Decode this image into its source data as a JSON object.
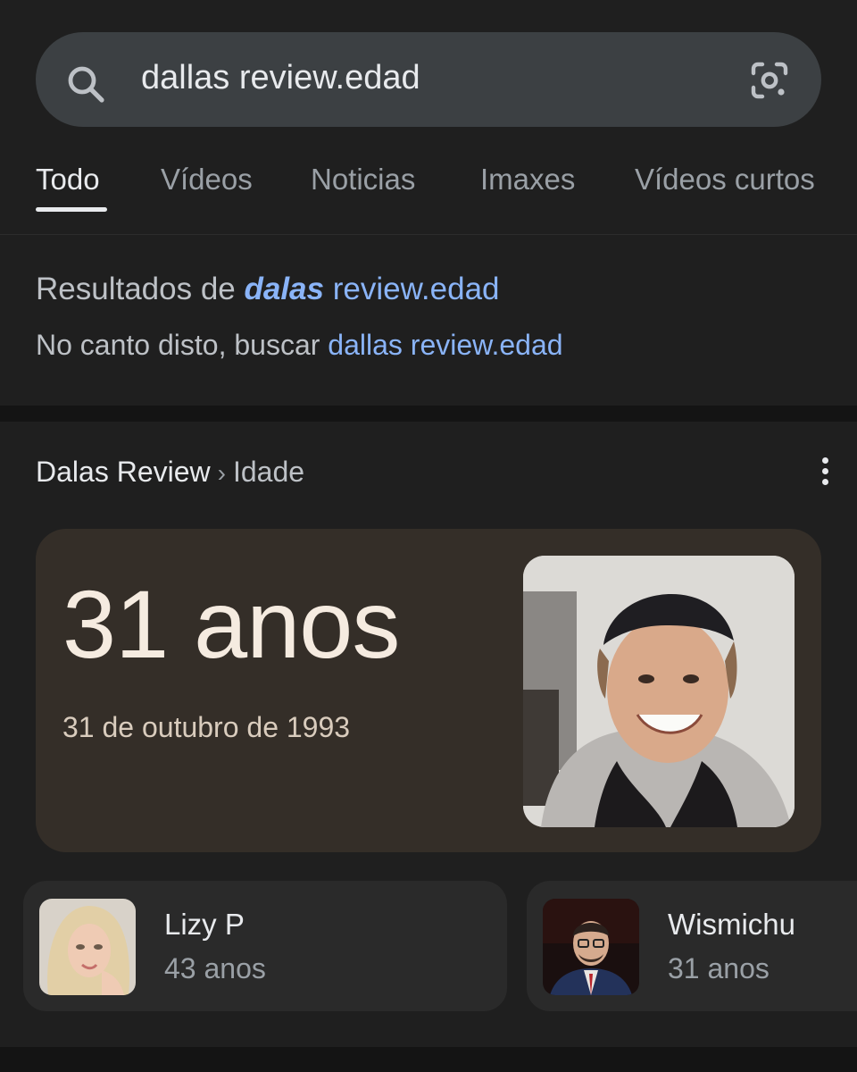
{
  "search": {
    "query": "dallas review.edad",
    "search_icon": "search-icon",
    "lens_icon": "google-lens-icon"
  },
  "tabs": [
    {
      "label": "Todo",
      "active": true
    },
    {
      "label": "Vídeos",
      "active": false
    },
    {
      "label": "Noticias",
      "active": false
    },
    {
      "label": "Imaxes",
      "active": false
    },
    {
      "label": "Vídeos curtos",
      "active": false
    }
  ],
  "spelling": {
    "prefix": "Resultados de ",
    "corrected_word": "dalas",
    "corrected_rest": " review.edad",
    "instead_prefix": "No canto disto, buscar ",
    "original_query": "dallas review.edad"
  },
  "breadcrumb": {
    "entity": "Dalas Review",
    "separator": "›",
    "attribute": "Idade"
  },
  "age_card": {
    "age": "31 anos",
    "birth_date": "31 de outubro de 1993",
    "photo": "portrait of young man with backwards cap"
  },
  "related": [
    {
      "name": "Lizy P",
      "age": "43 anos",
      "avatar": "blonde woman portrait"
    },
    {
      "name": "Wismichu",
      "age": "31 anos",
      "avatar": "man with glasses in suit"
    }
  ],
  "colors": {
    "background": "#1f1f1f",
    "search_bar": "#3c4043",
    "link": "#8ab4f8",
    "age_card_bg": "#342e28"
  }
}
